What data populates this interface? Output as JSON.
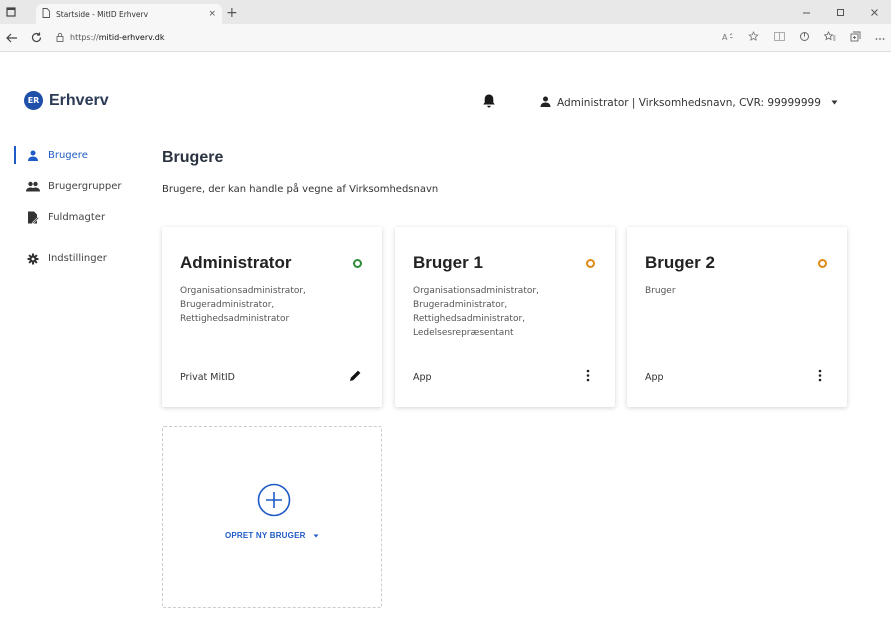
{
  "browser": {
    "tab_title": "Startside - MitID Erhverv",
    "tab_close": "×",
    "new_tab": "+",
    "url_prefix": "https://",
    "url_host": "mitid-erhverv.dk"
  },
  "app": {
    "logo_mark": "ER",
    "logo_text": "Erhverv",
    "user_menu_label": "Administrator | Virksomhedsnavn, CVR: 99999999",
    "accent_color": "#1f5bc6"
  },
  "sidebar": {
    "items": [
      {
        "label": "Brugere",
        "icon": "user-icon",
        "active": true
      },
      {
        "label": "Brugergrupper",
        "icon": "group-icon",
        "active": false
      },
      {
        "label": "Fuldmagter",
        "icon": "document-icon",
        "active": false
      },
      {
        "label": "Indstillinger",
        "icon": "gear-icon",
        "active": false
      }
    ]
  },
  "main": {
    "title": "Brugere",
    "subtitle": "Brugere, der kan handle på vegne af Virksomhedsnavn",
    "cards": [
      {
        "name": "Administrator",
        "status_color": "#2e8b3a",
        "roles": "Organisationsadministrator, Brugeradministrator, Rettighedsadministrator",
        "footer": "Privat MitID",
        "action_icon": "pencil-icon"
      },
      {
        "name": "Bruger 1",
        "status_color": "#e08a16",
        "roles": "Organisationsadministrator, Brugeradministrator, Rettighedsadministrator, Ledelsesrepræsentant",
        "footer": "App",
        "action_icon": "more-vertical-icon"
      },
      {
        "name": "Bruger 2",
        "status_color": "#e08a16",
        "roles": "Bruger",
        "footer": "App",
        "action_icon": "more-vertical-icon"
      }
    ],
    "create_label": "OPRET NY BRUGER"
  }
}
